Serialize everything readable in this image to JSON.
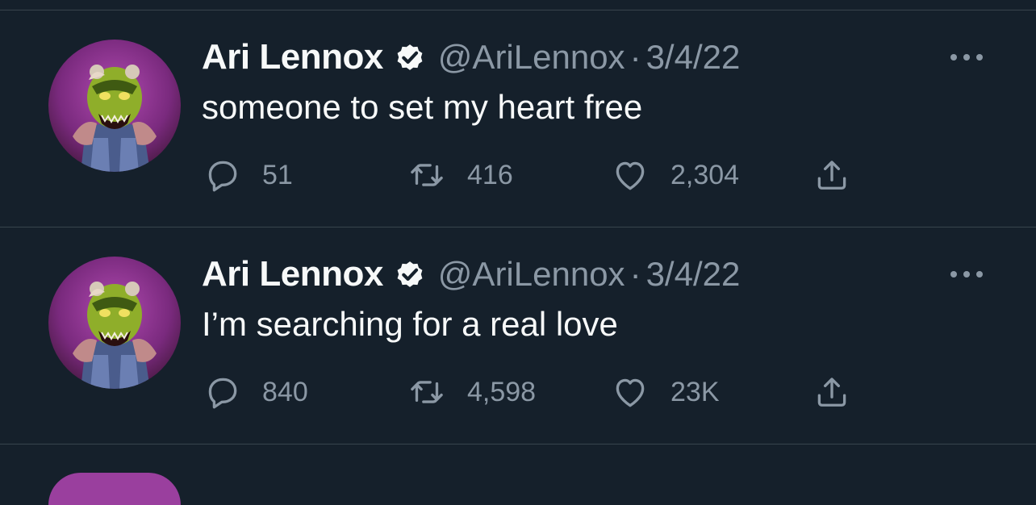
{
  "tweets": [
    {
      "author": "Ari Lennox",
      "handle": "@AriLennox",
      "separator": "·",
      "date": "3/4/22",
      "text": "someone to set my heart free",
      "replies": "51",
      "retweets": "416",
      "likes": "2,304",
      "avatar_icon": "profile-avatar",
      "verified_icon": "verified-badge-icon",
      "more_icon": "more-options-icon"
    },
    {
      "author": "Ari Lennox",
      "handle": "@AriLennox",
      "separator": "·",
      "date": "3/4/22",
      "text": "I’m searching for a real love",
      "replies": "840",
      "retweets": "4,598",
      "likes": "23K",
      "avatar_icon": "profile-avatar",
      "verified_icon": "verified-badge-icon",
      "more_icon": "more-options-icon"
    }
  ],
  "colors": {
    "background": "#15202b",
    "divider": "#38444d",
    "primary_text": "#f7f9f9",
    "secondary_text": "#8b98a5"
  }
}
